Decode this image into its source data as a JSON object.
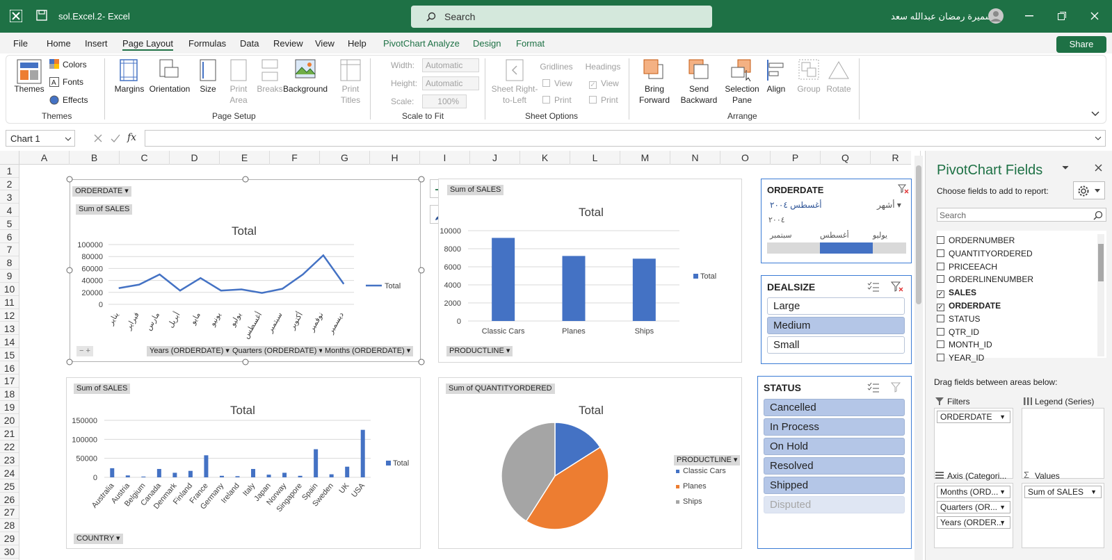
{
  "title_bar": {
    "file_name": "sol.Excel.2",
    "separator": "-",
    "app": "Excel",
    "search_placeholder": "Search",
    "user_name": "سميرة رمضان عبدالله سعد"
  },
  "menu": {
    "file": "File",
    "home": "Home",
    "insert": "Insert",
    "page_layout": "Page Layout",
    "formulas": "Formulas",
    "data": "Data",
    "review": "Review",
    "view": "View",
    "help": "Help",
    "pivotchart_analyze": "PivotChart Analyze",
    "design": "Design",
    "format": "Format",
    "share": "Share"
  },
  "ribbon": {
    "themes": {
      "themes": "Themes",
      "colors": "Colors",
      "fonts": "Fonts",
      "effects": "Effects",
      "group": "Themes"
    },
    "page_setup": {
      "margins": "Margins",
      "orientation": "Orientation",
      "size": "Size",
      "print_area_1": "Print",
      "print_area_2": "Area",
      "breaks": "Breaks",
      "background": "Background",
      "print_titles_1": "Print",
      "print_titles_2": "Titles",
      "group": "Page Setup"
    },
    "scale": {
      "width": "Width:",
      "width_val": "Automatic",
      "height": "Height:",
      "height_val": "Automatic",
      "scale": "Scale:",
      "scale_val": "100%",
      "group": "Scale to Fit"
    },
    "sheet_options": {
      "sheet_right_1": "Sheet Right-",
      "sheet_right_2": "to-Left",
      "gridlines": "Gridlines",
      "headings": "Headings",
      "view": "View",
      "print": "Print",
      "group": "Sheet Options"
    },
    "arrange": {
      "bring_1": "Bring",
      "bring_2": "Forward",
      "send_1": "Send",
      "send_2": "Backward",
      "selection_1": "Selection",
      "selection_2": "Pane",
      "align": "Align",
      "group_btn": "Group",
      "rotate": "Rotate",
      "group": "Arrange"
    }
  },
  "formula_bar": {
    "name_box": "Chart 1",
    "fx": "fx",
    "value": ""
  },
  "columns": [
    "A",
    "B",
    "C",
    "D",
    "E",
    "F",
    "G",
    "H",
    "I",
    "J",
    "K",
    "L",
    "M",
    "N",
    "O",
    "P",
    "Q",
    "R"
  ],
  "rows": [
    "1",
    "2",
    "3",
    "4",
    "5",
    "6",
    "7",
    "8",
    "9",
    "10",
    "11",
    "12",
    "13",
    "14",
    "15",
    "16",
    "17",
    "18",
    "19",
    "20",
    "21",
    "22",
    "23",
    "24",
    "25",
    "26",
    "27",
    "28",
    "29",
    "30"
  ],
  "charts": {
    "line": {
      "filter": "ORDERDATE",
      "value_btn": "Sum of SALES",
      "title": "Total",
      "legend": "Total",
      "axis_buttons": [
        "Years (ORDERDATE)",
        "Quarters (ORDERDATE)",
        "Months (ORDERDATE)"
      ],
      "y_ticks": [
        "100000",
        "80000",
        "60000",
        "40000",
        "20000",
        "0"
      ]
    },
    "bar_product": {
      "value_btn": "Sum of SALES",
      "title": "Total",
      "legend": "Total",
      "axis_btn": "PRODUCTLINE",
      "y_ticks": [
        "10000",
        "8000",
        "6000",
        "4000",
        "2000",
        "0"
      ]
    },
    "bar_country": {
      "value_btn": "Sum of SALES",
      "title": "Total",
      "legend": "Total",
      "axis_btn": "COUNTRY",
      "y_ticks": [
        "150000",
        "100000",
        "50000",
        "0"
      ]
    },
    "pie": {
      "value_btn": "Sum of QUANTITYORDERED",
      "title": "Total",
      "legend_btn": "PRODUCTLINE"
    }
  },
  "chart_data": [
    {
      "type": "line",
      "title": "Total",
      "series": [
        {
          "name": "Total",
          "values": [
            27000,
            33000,
            50000,
            23000,
            44000,
            23000,
            25000,
            19000,
            26000,
            50000,
            82000,
            34000
          ]
        }
      ],
      "categories": [
        "يناير",
        "فبراير",
        "مارس",
        "أبريل",
        "مايو",
        "يونيو",
        "يوليو",
        "أغسطس",
        "سبتمبر",
        "أكتوبر",
        "نوفمبر",
        "ديسمبر"
      ],
      "ylim": [
        0,
        100000
      ],
      "grid": true,
      "legend_position": "right"
    },
    {
      "type": "bar",
      "title": "Total",
      "categories": [
        "Classic Cars",
        "Planes",
        "Ships"
      ],
      "series": [
        {
          "name": "Total",
          "values": [
            9200,
            7200,
            6900
          ]
        }
      ],
      "ylim": [
        0,
        10000
      ],
      "grid": true,
      "legend_position": "right"
    },
    {
      "type": "bar",
      "title": "Total",
      "categories": [
        "Australia",
        "Austria",
        "Belgium",
        "Canada",
        "Denmark",
        "Finland",
        "France",
        "Germany",
        "Ireland",
        "Italy",
        "Japan",
        "Norway",
        "Singapore",
        "Spain",
        "Sweden",
        "UK",
        "USA"
      ],
      "series": [
        {
          "name": "Total",
          "values": [
            24000,
            5000,
            2000,
            22000,
            12000,
            17000,
            58000,
            4000,
            3000,
            22000,
            7000,
            12000,
            4000,
            74000,
            8000,
            28000,
            125000
          ]
        }
      ],
      "ylim": [
        0,
        150000
      ],
      "grid": true,
      "legend_position": "right"
    },
    {
      "type": "pie",
      "title": "Total",
      "categories": [
        "Classic Cars",
        "Planes",
        "Ships"
      ],
      "values": [
        16,
        43,
        41
      ],
      "legend_position": "right"
    }
  ],
  "slicers": {
    "orderdate": {
      "title": "ORDERDATE",
      "selection": "أغسطس ٢٠٠٤",
      "level": "أشهر",
      "year": "٢٠٠٤",
      "months": [
        "يوليو",
        "أغسطس",
        "سبتمبر"
      ]
    },
    "dealsize": {
      "title": "DEALSIZE",
      "items": [
        "Large",
        "Medium",
        "Small"
      ]
    },
    "status": {
      "title": "STATUS",
      "items": [
        "Cancelled",
        "In Process",
        "On Hold",
        "Resolved",
        "Shipped",
        "Disputed"
      ]
    }
  },
  "pane": {
    "title": "PivotChart Fields",
    "subtitle": "Choose fields to add to report:",
    "search_placeholder": "Search",
    "fields": [
      "ORDERNUMBER",
      "QUANTITYORDERED",
      "PRICEEACH",
      "ORDERLINENUMBER",
      "SALES",
      "ORDERDATE",
      "STATUS",
      "QTR_ID",
      "MONTH_ID",
      "YEAR_ID"
    ],
    "drag_label": "Drag fields between areas below:",
    "filters_label": "Filters",
    "legend_label": "Legend (Series)",
    "axis_label": "Axis (Categori...",
    "values_label": "Values",
    "filter_pill": "ORDERDATE",
    "axis_pills": [
      "Months (ORD...",
      "Quarters (OR...",
      "Years (ORDER..."
    ],
    "values_pill": "Sum of SALES"
  },
  "colors": {
    "excel_green": "#1e7145",
    "blue": "#4472c4",
    "orange": "#ed7d31",
    "gray": "#a5a5a5",
    "slicer_selected": "#b4c6e7"
  }
}
